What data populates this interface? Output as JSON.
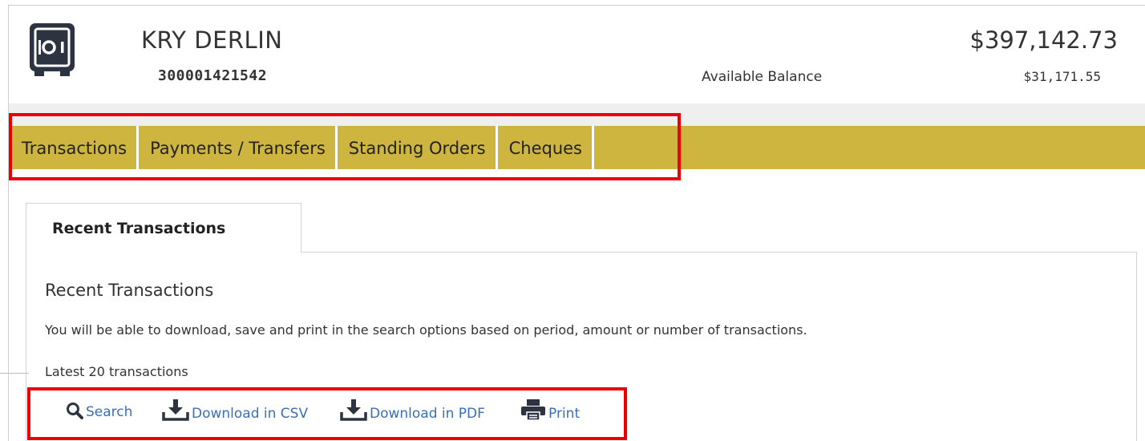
{
  "account": {
    "name": "KRY DERLIN",
    "number": "300001421542",
    "balance": "$397,142.73",
    "available_label": "Available Balance",
    "available_value": "$31,171.55"
  },
  "nav": {
    "tabs": [
      {
        "label": "Transactions"
      },
      {
        "label": "Payments / Transfers"
      },
      {
        "label": "Standing Orders"
      },
      {
        "label": "Cheques"
      }
    ]
  },
  "section": {
    "tab_label": "Recent Transactions",
    "title": "Recent Transactions",
    "description": "You will be able to download, save and print in the search options based on period, amount or number of transactions.",
    "latest": "Latest 20 transactions"
  },
  "actions": {
    "search": "Search",
    "download_csv": "Download in CSV",
    "download_pdf": "Download in PDF",
    "print": "Print"
  },
  "colors": {
    "nav_bg": "#cdb53f",
    "highlight": "#ee0000",
    "link": "#3a6fb7",
    "icon": "#2b3440"
  },
  "icons": {
    "account": "safe-icon",
    "search": "search-icon",
    "download": "download-icon",
    "print": "print-icon"
  }
}
